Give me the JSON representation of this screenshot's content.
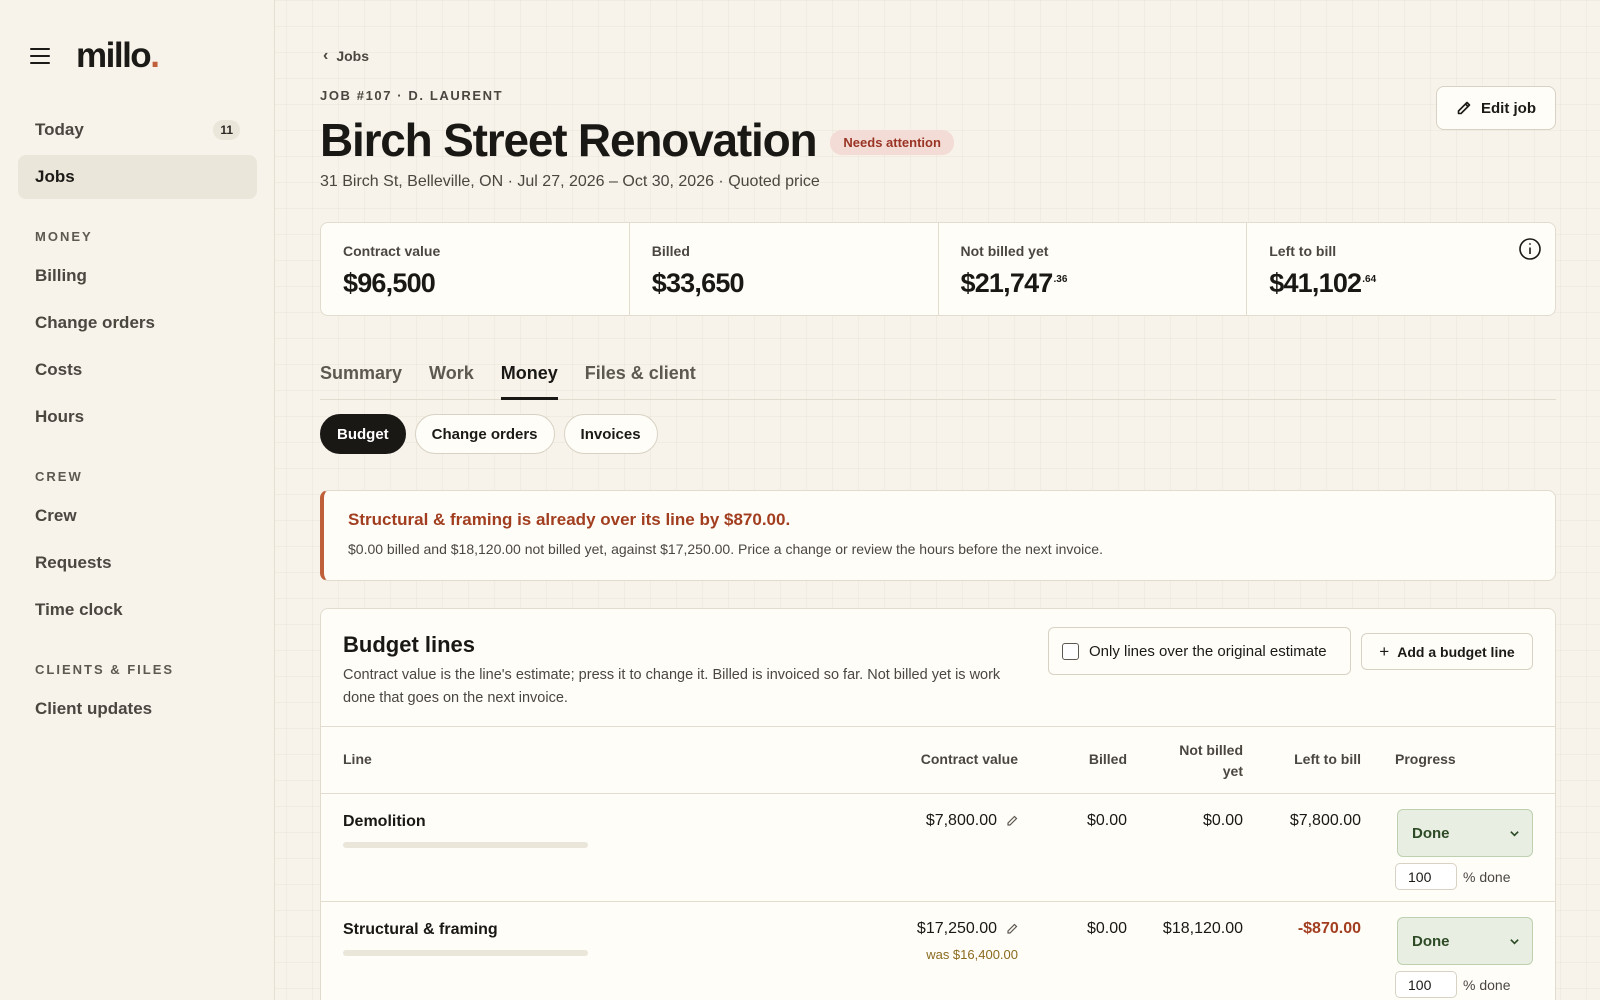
{
  "sidebar": {
    "logo": "millo",
    "logo_dot": ".",
    "nav_top": [
      {
        "label": "Today",
        "count": "11"
      },
      {
        "label": "Jobs"
      }
    ],
    "sections": [
      {
        "title": "MONEY",
        "items": [
          "Billing",
          "Change orders",
          "Costs",
          "Hours"
        ]
      },
      {
        "title": "CREW",
        "items": [
          "Crew",
          "Requests",
          "Time clock"
        ]
      },
      {
        "title": "CLIENTS & FILES",
        "items": [
          "Client updates"
        ]
      }
    ]
  },
  "header": {
    "back_label": "Jobs",
    "eyebrow": "JOB #107 · D. LAURENT",
    "title": "Birch Street Renovation",
    "badge": "Needs attention",
    "subline": "31 Birch St, Belleville, ON · Jul 27, 2026 – Oct 30, 2026 · Quoted price",
    "edit_label": "Edit job"
  },
  "stats": [
    {
      "label": "Contract value",
      "value": "$96,500",
      "cents": ""
    },
    {
      "label": "Billed",
      "value": "$33,650",
      "cents": ""
    },
    {
      "label": "Not billed yet",
      "value": "$21,747",
      "cents": ".36"
    },
    {
      "label": "Left to bill",
      "value": "$41,102",
      "cents": ".64"
    }
  ],
  "tabs": [
    "Summary",
    "Work",
    "Money",
    "Files & client"
  ],
  "active_tab": "Money",
  "pills": [
    "Budget",
    "Change orders",
    "Invoices"
  ],
  "active_pill": "Budget",
  "alert": {
    "title": "Structural & framing is already over its line by $870.00.",
    "body": "$0.00 billed and $18,120.00 not billed yet, against $17,250.00. Price a change or review the hours before the next invoice."
  },
  "budget": {
    "title": "Budget lines",
    "description": "Contract value is the line's estimate; press it to change it. Billed is invoiced so far. Not billed yet is work done that goes on the next invoice.",
    "filter_label": "Only lines over the original estimate",
    "filter_checked": false,
    "add_label": "Add a budget line",
    "columns": {
      "line": "Line",
      "contract": "Contract value",
      "billed": "Billed",
      "not_billed_1": "Not billed",
      "not_billed_2": "yet",
      "left": "Left to bill",
      "progress": "Progress"
    },
    "rows": [
      {
        "name": "Demolition",
        "contract": "$7,800.00",
        "was": "",
        "billed": "$0.00",
        "not_billed": "$0.00",
        "left": "$7,800.00",
        "left_negative": false,
        "status": "Done",
        "pct": "100",
        "pct_suffix": "% done"
      },
      {
        "name": "Structural & framing",
        "contract": "$17,250.00",
        "was": "was $16,400.00",
        "billed": "$0.00",
        "not_billed": "$18,120.00",
        "left": "-$870.00",
        "left_negative": true,
        "status": "Done",
        "pct": "100",
        "pct_suffix": "% done"
      }
    ]
  },
  "colors": {
    "accent": "#c0603a",
    "alert_text": "#a23e20",
    "badge_bg": "#f3dcd6",
    "status_bg": "#e8efe2"
  }
}
